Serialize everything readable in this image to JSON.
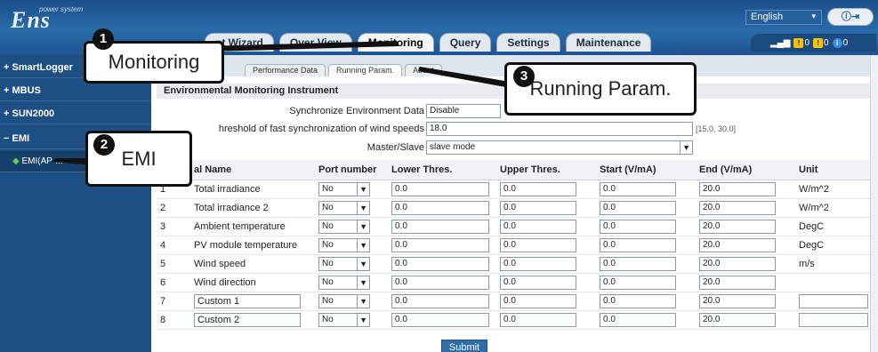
{
  "header": {
    "logo": "Ens",
    "logo_sub": "power system",
    "language": "English",
    "logout_label": "",
    "nav_tabs": [
      "nt Wizard",
      "Over View",
      "Monitoring",
      "Query",
      "Settings",
      "Maintenance"
    ],
    "alarms": [
      {
        "count": "0",
        "color": "#f2c40f"
      },
      {
        "count": "0",
        "color": "#f2c40f"
      },
      {
        "count": "0",
        "color": "#3b8de0"
      }
    ]
  },
  "sidebar": {
    "items": [
      "SmartLogger",
      "MBUS",
      "SUN2000",
      "EMI",
      "EMI(AP-..."
    ]
  },
  "sub_tabs": [
    "Performance Data",
    "Running Param.",
    "About"
  ],
  "section_title": "Environmental Monitoring Instrument",
  "form": {
    "sync_label": "Synchronize Environment Data",
    "sync_value": "Disable",
    "threshold_label": "hreshold of fast synchronization of wind speeds",
    "threshold_value": "18.0",
    "threshold_hint": "[15.0, 30.0]",
    "master_label": "Master/Slave",
    "master_value": "slave mode"
  },
  "table": {
    "headers": [
      "",
      "al Name",
      "Port number",
      "Lower Thres.",
      "Upper Thres.",
      "Start (V/mA)",
      "End (V/mA)",
      "Unit"
    ],
    "rows": [
      {
        "no": "1",
        "name": "Total irradiance",
        "port": "No",
        "lower": "0.0",
        "upper": "0.0",
        "start": "0.0",
        "end": "20.0",
        "unit": "W/m^2"
      },
      {
        "no": "2",
        "name": "Total irradiance 2",
        "port": "No",
        "lower": "0.0",
        "upper": "0.0",
        "start": "0.0",
        "end": "20.0",
        "unit": "W/m^2"
      },
      {
        "no": "3",
        "name": "Ambient temperature",
        "port": "No",
        "lower": "0.0",
        "upper": "0.0",
        "start": "0.0",
        "end": "20.0",
        "unit": "DegC"
      },
      {
        "no": "4",
        "name": "PV module temperature",
        "port": "No",
        "lower": "0.0",
        "upper": "0.0",
        "start": "0.0",
        "end": "20.0",
        "unit": "DegC"
      },
      {
        "no": "5",
        "name": "Wind speed",
        "port": "No",
        "lower": "0.0",
        "upper": "0.0",
        "start": "0.0",
        "end": "20.0",
        "unit": "m/s"
      },
      {
        "no": "6",
        "name": "Wind direction",
        "port": "No",
        "lower": "0.0",
        "upper": "0.0",
        "start": "0.0",
        "end": "20.0",
        "unit": ""
      },
      {
        "no": "7",
        "name": "Custom 1",
        "port": "No",
        "lower": "0.0",
        "upper": "0.0",
        "start": "0.0",
        "end": "20.0",
        "unit": ""
      },
      {
        "no": "8",
        "name": "Custom 2",
        "port": "No",
        "lower": "0.0",
        "upper": "0.0",
        "start": "0.0",
        "end": "20.0",
        "unit": ""
      }
    ]
  },
  "submit_label": "Submit",
  "callouts": [
    {
      "num": "1",
      "text": "Monitoring"
    },
    {
      "num": "2",
      "text": "EMI"
    },
    {
      "num": "3",
      "text": "Running Param."
    }
  ]
}
